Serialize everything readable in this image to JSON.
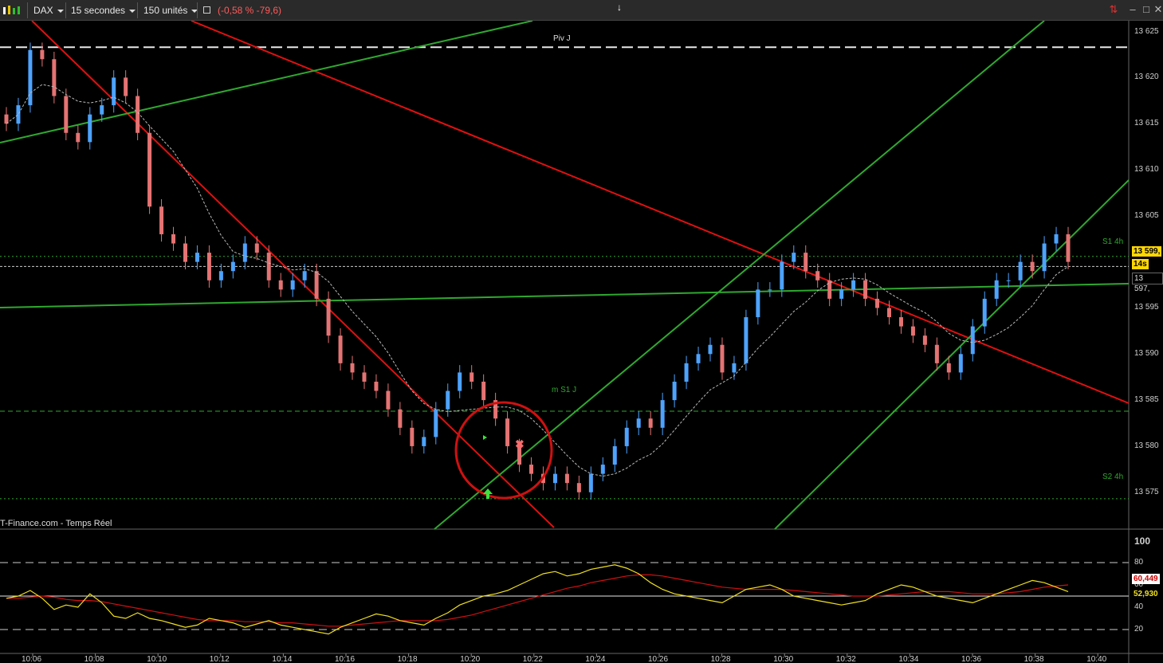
{
  "toolbar": {
    "symbol": "DAX",
    "timeframe": "15 secondes",
    "units": "150 unités",
    "change": "(-0,58 % -79,6)"
  },
  "chart_labels": {
    "pivot": "Piv J",
    "s1": "S1 4h",
    "s2": "S2 4h",
    "mid": "m S1 J",
    "source": "T-Finance.com - Temps Réel"
  },
  "price_axis": {
    "ticks": [
      "13 625",
      "13 620",
      "13 615",
      "13 610",
      "13 605",
      "13 600",
      "13 595",
      "13 590",
      "13 585",
      "13 580",
      "13 575"
    ],
    "last_price": "13 599,",
    "countdown": "14s",
    "ma_value": "13 597,"
  },
  "indicator_axis": {
    "ticks": [
      "100",
      "80",
      "60",
      "40",
      "20"
    ],
    "red_value": "60,449",
    "yellow_value": "52,930"
  },
  "time_axis": [
    "10:06",
    "10:08",
    "10:10",
    "10:12",
    "10:14",
    "10:16",
    "10:18",
    "10:20",
    "10:22",
    "10:24",
    "10:26",
    "10:28",
    "10:30",
    "10:32",
    "10:34",
    "10:36",
    "10:38",
    "10:40"
  ],
  "colors": {
    "bull": "#4da3ff",
    "bear": "#e57373",
    "trend_red": "#e01010",
    "trend_green": "#2fa82f",
    "stoch": "#f0e020",
    "signal": "#d01010"
  },
  "chart_data": {
    "type": "candlestick",
    "price_range": [
      13571,
      13626
    ],
    "levels": {
      "pivot": 13623.3,
      "s1": 13600.6,
      "s2": 13574.3,
      "mid": 13583.8,
      "last": 13599.5,
      "ma": 13597.3
    },
    "candles_close": [
      13615,
      13617,
      13623,
      13622,
      13618,
      13614,
      13613,
      13616,
      13617,
      13620,
      13618,
      13614,
      13606,
      13603,
      13602,
      13600,
      13601,
      13598,
      13599,
      13600,
      13602,
      13601,
      13598,
      13597,
      13598,
      13599,
      13596,
      13592,
      13589,
      13588,
      13587,
      13586,
      13584,
      13582,
      13580,
      13581,
      13584,
      13586,
      13588,
      13587,
      13585,
      13583,
      13580,
      13578,
      13577,
      13576,
      13577,
      13576,
      13575,
      13577,
      13578,
      13580,
      13582,
      13583,
      13582,
      13585,
      13587,
      13589,
      13590,
      13591,
      13588,
      13589,
      13594,
      13597,
      13597,
      13600,
      13601,
      13599,
      13598,
      13596,
      13597,
      13598,
      13596,
      13595,
      13594,
      13593,
      13592,
      13591,
      13589,
      13588,
      13590,
      13593,
      13596,
      13598,
      13598,
      13600,
      13599,
      13602,
      13603,
      13600
    ],
    "stoch_y": [
      48,
      50,
      55,
      48,
      38,
      42,
      40,
      52,
      44,
      32,
      30,
      35,
      30,
      28,
      25,
      22,
      24,
      30,
      28,
      26,
      22,
      25,
      28,
      24,
      22,
      20,
      18,
      16,
      22,
      26,
      30,
      34,
      32,
      28,
      26,
      24,
      30,
      35,
      42,
      46,
      50,
      52,
      55,
      60,
      65,
      70,
      72,
      68,
      70,
      74,
      76,
      78,
      75,
      70,
      62,
      56,
      52,
      50,
      48,
      46,
      44,
      50,
      56,
      58,
      60,
      56,
      50,
      48,
      46,
      44,
      42,
      44,
      46,
      52,
      56,
      60,
      58,
      54,
      50,
      48,
      46,
      44,
      48,
      52,
      56,
      60,
      64,
      62,
      58,
      54
    ],
    "signal_y": [
      48,
      48,
      49,
      50,
      49,
      47,
      46,
      46,
      45,
      43,
      41,
      39,
      37,
      35,
      33,
      31,
      29,
      28,
      28,
      28,
      27,
      27,
      27,
      26,
      26,
      25,
      24,
      23,
      23,
      24,
      25,
      26,
      27,
      28,
      28,
      28,
      28,
      29,
      31,
      33,
      36,
      39,
      42,
      45,
      48,
      51,
      54,
      57,
      59,
      62,
      64,
      66,
      68,
      69,
      69,
      68,
      66,
      64,
      62,
      60,
      58,
      57,
      56,
      56,
      56,
      56,
      55,
      54,
      53,
      52,
      51,
      50,
      50,
      50,
      51,
      52,
      53,
      54,
      54,
      54,
      53,
      52,
      52,
      52,
      53,
      54,
      56,
      58,
      59,
      60
    ]
  }
}
